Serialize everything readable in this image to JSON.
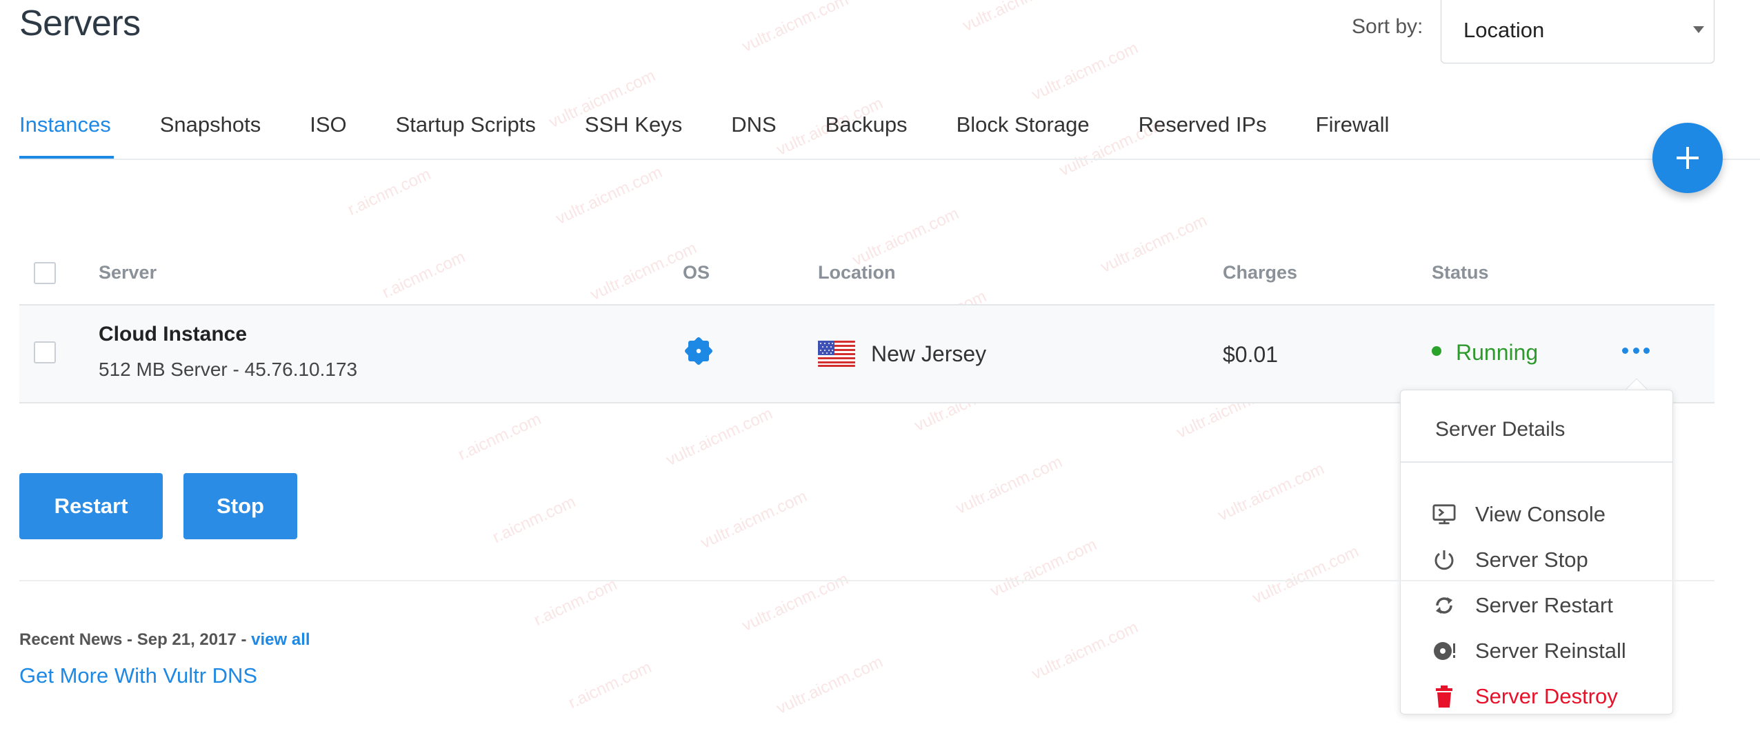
{
  "header": {
    "title": "Servers",
    "sort_label": "Sort by:",
    "sort_value": "Location"
  },
  "tabs": [
    {
      "label": "Instances",
      "active": true
    },
    {
      "label": "Snapshots"
    },
    {
      "label": "ISO"
    },
    {
      "label": "Startup Scripts"
    },
    {
      "label": "SSH Keys"
    },
    {
      "label": "DNS"
    },
    {
      "label": "Backups"
    },
    {
      "label": "Block Storage"
    },
    {
      "label": "Reserved IPs"
    },
    {
      "label": "Firewall"
    }
  ],
  "add_button_icon": "plus-icon",
  "table": {
    "columns": {
      "server": "Server",
      "os": "OS",
      "location": "Location",
      "charges": "Charges",
      "status": "Status"
    },
    "rows": [
      {
        "name": "Cloud Instance",
        "details": "512 MB Server - 45.76.10.173",
        "os_icon": "os-gear-icon",
        "location_flag": "us-flag-icon",
        "location": "New Jersey",
        "charges": "$0.01",
        "status": "Running",
        "status_color": "#29a329"
      }
    ]
  },
  "actions": {
    "restart": "Restart",
    "stop": "Stop"
  },
  "news": {
    "prefix": "Recent News - Sep 21, 2017 - ",
    "view_all": "view all",
    "headline": "Get More With Vultr DNS"
  },
  "menu": {
    "header": "Server Details",
    "items": [
      {
        "label": "View Console",
        "icon": "console-icon"
      },
      {
        "label": "Server Stop",
        "icon": "power-icon"
      },
      {
        "label": "Server Restart",
        "icon": "refresh-icon"
      },
      {
        "label": "Server Reinstall",
        "icon": "disc-icon"
      },
      {
        "label": "Server Destroy",
        "icon": "trash-icon",
        "danger": true
      }
    ]
  },
  "colors": {
    "accent": "#1e88e5",
    "running": "#29a329",
    "danger": "#e8112a"
  },
  "watermark": [
    "vultr.aicnm.com",
    "r.aicnm.com"
  ]
}
